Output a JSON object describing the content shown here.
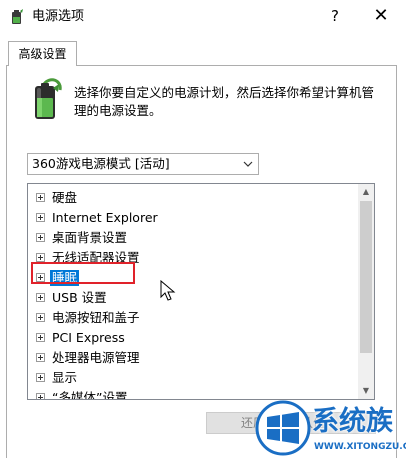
{
  "window": {
    "title": "电源选项",
    "help_label": "?",
    "close_label": "✕"
  },
  "tab": {
    "label": "高级设置"
  },
  "description": "选择你要自定义的电源计划，然后选择你希望计算机管理的电源设置。",
  "plan_select": {
    "value": "360游戏电源模式 [活动]"
  },
  "tree": {
    "items": [
      {
        "label": "硬盘"
      },
      {
        "label": "Internet Explorer"
      },
      {
        "label": "桌面背景设置"
      },
      {
        "label": "无线适配器设置"
      },
      {
        "label": "睡眠",
        "selected": true
      },
      {
        "label": "USB 设置"
      },
      {
        "label": "电源按钮和盖子"
      },
      {
        "label": "PCI Express"
      },
      {
        "label": "处理器电源管理"
      },
      {
        "label": "显示"
      },
      {
        "label": "“多媒体”设置"
      }
    ]
  },
  "restore_button": {
    "label": "还原计划默认值"
  },
  "watermark": {
    "text": "系统族",
    "url": "WWW.XITONGZU.COM"
  },
  "colors": {
    "selection": "#0078d7",
    "highlight_border": "#e0222a",
    "watermark": "#1a6ec4"
  },
  "icons": {
    "window_icon": "power-options-battery-icon",
    "expander": "plus-expander-icon",
    "dropdown": "chevron-down-icon",
    "cursor": "mouse-pointer-icon",
    "watermark_logo": "windows-logo-icon"
  }
}
